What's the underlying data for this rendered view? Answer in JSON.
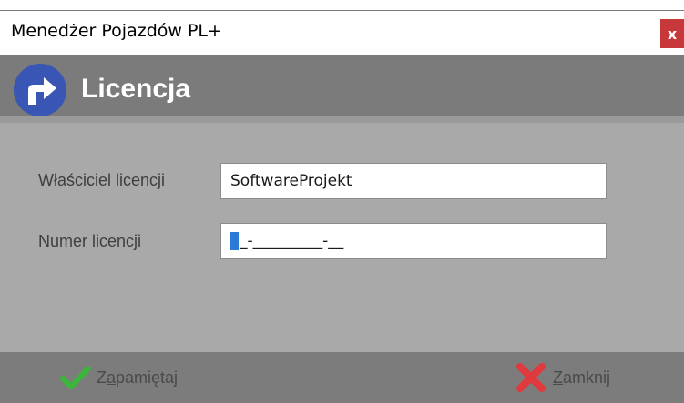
{
  "window": {
    "title": "Menedżer Pojazdów PL+",
    "close_label": "x"
  },
  "header": {
    "title": "Licencja"
  },
  "form": {
    "owner_label": "Właściciel licencji",
    "owner_value": "SoftwareProjekt",
    "number_label": "Numer licencji",
    "number_value": "_-_________-__"
  },
  "footer": {
    "save_prefix": "Z",
    "save_underlined": "a",
    "save_rest": "pamiętaj",
    "close_underlined": "Z",
    "close_rest": "amknij"
  },
  "colors": {
    "header_icon": "#3a56b4",
    "close_button": "#c8383a",
    "check_icon": "#3bb53b",
    "x_icon": "#e0393e"
  }
}
